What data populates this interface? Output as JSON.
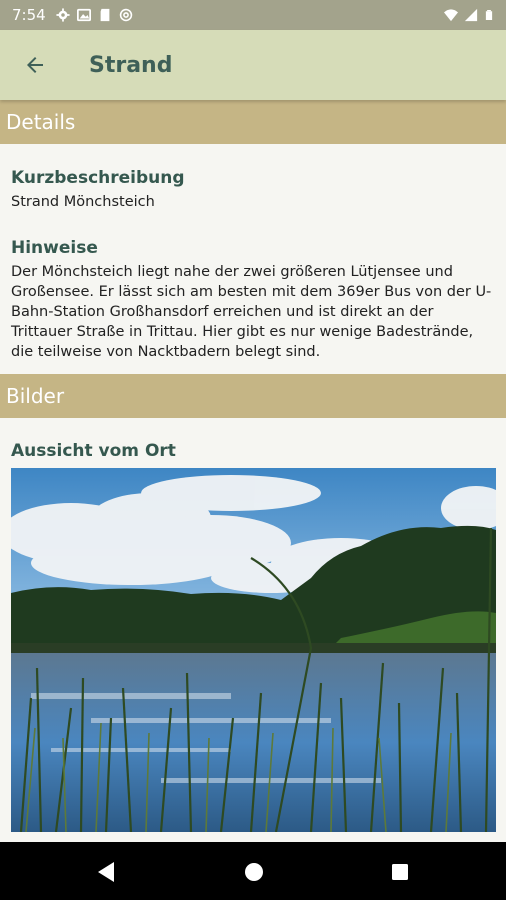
{
  "status_bar": {
    "time": "7:54",
    "left_icons": [
      "gear-icon",
      "photo-icon",
      "sd-card-icon",
      "at-icon"
    ],
    "right_icons": [
      "wifi-icon",
      "signal-icon",
      "battery-icon"
    ]
  },
  "app_bar": {
    "back_icon": "arrow-back-icon",
    "title": "Strand"
  },
  "sections": {
    "details": "Details",
    "bilder": "Bilder"
  },
  "details": {
    "kurzbeschreibung_title": "Kurzbeschreibung",
    "kurzbeschreibung_text": "Strand Mönchsteich",
    "hinweise_title": "Hinweise",
    "hinweise_text": "Der Mönchsteich liegt nahe der zwei größeren Lütjensee und Großensee. Er lässt sich am besten mit dem 369er Bus von der U-Bahn-Station Großhansdorf erreichen und ist direkt an der Trittauer Straße in Trittau. Hier gibt es nur wenige Badestrände, die teilweise von Nacktbadern belegt sind."
  },
  "bilder": {
    "caption": "Aussicht vom Ort"
  },
  "nav_bar": {
    "icons": [
      "back-triangle-icon",
      "home-circle-icon",
      "recents-square-icon"
    ]
  },
  "colors": {
    "status_bar": "#a3a38c",
    "app_bar": "#d6dcb8",
    "accent_text": "#3f6058",
    "section_header": "#c5b585",
    "background": "#f6f6f2"
  }
}
